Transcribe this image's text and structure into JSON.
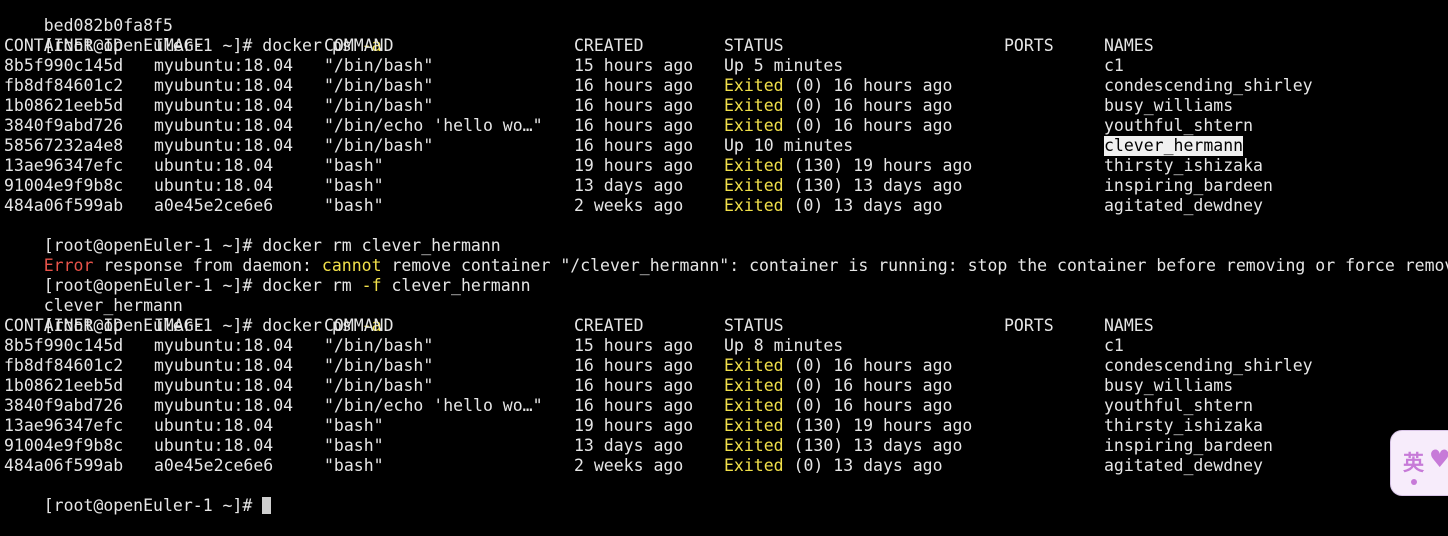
{
  "prompt": "[root@openEuler-1 ~]# ",
  "partial_top_line": "bed082b0fa8f5",
  "cmd_ps": "docker ps",
  "flag_a": "-a",
  "cmd_rm_prefix": "docker rm",
  "rm_target": "clever_hermann",
  "flag_f": "-f",
  "headers": {
    "id": "CONTAINER ID",
    "image": "IMAGE",
    "command": "COMMAND",
    "created": "CREATED",
    "status": "STATUS",
    "ports": "PORTS",
    "names": "NAMES"
  },
  "status_words": {
    "up": "Up",
    "exited": "Exited"
  },
  "table1": [
    {
      "id": "8b5f990c145d",
      "image": "myubuntu:18.04",
      "command": "\"/bin/bash\"",
      "created": "15 hours ago",
      "status_kind": "up",
      "status_rest": " 5 minutes",
      "ports": "",
      "names": "c1"
    },
    {
      "id": "fb8df84601c2",
      "image": "myubuntu:18.04",
      "command": "\"/bin/bash\"",
      "created": "16 hours ago",
      "status_kind": "exited",
      "status_rest": " (0) 16 hours ago",
      "ports": "",
      "names": "condescending_shirley"
    },
    {
      "id": "1b08621eeb5d",
      "image": "myubuntu:18.04",
      "command": "\"/bin/bash\"",
      "created": "16 hours ago",
      "status_kind": "exited",
      "status_rest": " (0) 16 hours ago",
      "ports": "",
      "names": "busy_williams"
    },
    {
      "id": "3840f9abd726",
      "image": "myubuntu:18.04",
      "command": "\"/bin/echo 'hello wo…\"",
      "created": "16 hours ago",
      "status_kind": "exited",
      "status_rest": " (0) 16 hours ago",
      "ports": "",
      "names": "youthful_shtern"
    },
    {
      "id": "58567232a4e8",
      "image": "myubuntu:18.04",
      "command": "\"/bin/bash\"",
      "created": "16 hours ago",
      "status_kind": "up",
      "status_rest": " 10 minutes",
      "ports": "",
      "names": "clever_hermann",
      "selected": true
    },
    {
      "id": "13ae96347efc",
      "image": "ubuntu:18.04",
      "command": "\"bash\"",
      "created": "19 hours ago",
      "status_kind": "exited",
      "status_rest": " (130) 19 hours ago",
      "ports": "",
      "names": "thirsty_ishizaka"
    },
    {
      "id": "91004e9f9b8c",
      "image": "ubuntu:18.04",
      "command": "\"bash\"",
      "created": "13 days ago",
      "status_kind": "exited",
      "status_rest": " (130) 13 days ago",
      "ports": "",
      "names": "inspiring_bardeen"
    },
    {
      "id": "484a06f599ab",
      "image": "a0e45e2ce6e6",
      "command": "\"bash\"",
      "created": "2 weeks ago",
      "status_kind": "exited",
      "status_rest": " (0) 13 days ago",
      "ports": "",
      "names": "agitated_dewdney"
    }
  ],
  "error": {
    "word": "Error",
    "part1": " response from daemon: ",
    "cannot": "cannot",
    "part2": " remove container \"/clever_hermann\": container is running: stop the container before removing or force remove"
  },
  "rm_output": "clever_hermann",
  "table2": [
    {
      "id": "8b5f990c145d",
      "image": "myubuntu:18.04",
      "command": "\"/bin/bash\"",
      "created": "15 hours ago",
      "status_kind": "up",
      "status_rest": " 8 minutes",
      "ports": "",
      "names": "c1"
    },
    {
      "id": "fb8df84601c2",
      "image": "myubuntu:18.04",
      "command": "\"/bin/bash\"",
      "created": "16 hours ago",
      "status_kind": "exited",
      "status_rest": " (0) 16 hours ago",
      "ports": "",
      "names": "condescending_shirley"
    },
    {
      "id": "1b08621eeb5d",
      "image": "myubuntu:18.04",
      "command": "\"/bin/bash\"",
      "created": "16 hours ago",
      "status_kind": "exited",
      "status_rest": " (0) 16 hours ago",
      "ports": "",
      "names": "busy_williams"
    },
    {
      "id": "3840f9abd726",
      "image": "myubuntu:18.04",
      "command": "\"/bin/echo 'hello wo…\"",
      "created": "16 hours ago",
      "status_kind": "exited",
      "status_rest": " (0) 16 hours ago",
      "ports": "",
      "names": "youthful_shtern"
    },
    {
      "id": "13ae96347efc",
      "image": "ubuntu:18.04",
      "command": "\"bash\"",
      "created": "19 hours ago",
      "status_kind": "exited",
      "status_rest": " (130) 19 hours ago",
      "ports": "",
      "names": "thirsty_ishizaka"
    },
    {
      "id": "91004e9f9b8c",
      "image": "ubuntu:18.04",
      "command": "\"bash\"",
      "created": "13 days ago",
      "status_kind": "exited",
      "status_rest": " (130) 13 days ago",
      "ports": "",
      "names": "inspiring_bardeen"
    },
    {
      "id": "484a06f599ab",
      "image": "a0e45e2ce6e6",
      "command": "\"bash\"",
      "created": "2 weeks ago",
      "status_kind": "exited",
      "status_rest": " (0) 13 days ago",
      "ports": "",
      "names": "agitated_dewdney"
    }
  ],
  "ime_widget": {
    "glyph": "英",
    "icon": "heart-icon"
  },
  "colors": {
    "background": "#000000",
    "foreground": "#e6e6e6",
    "exited": "#f2e14a",
    "error": "#e8534a",
    "selection": "#f0f0f0"
  }
}
